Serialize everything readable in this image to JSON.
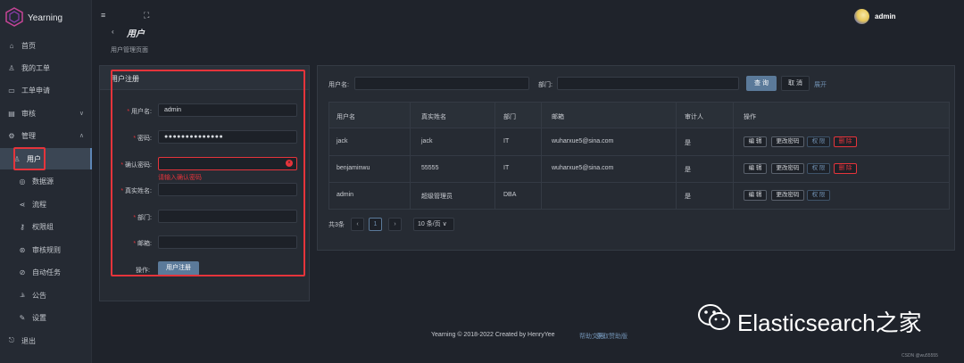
{
  "app": {
    "name": "Yearning"
  },
  "sidebar": {
    "items": [
      {
        "label": "首页",
        "icon": "home-icon"
      },
      {
        "label": "我的工单",
        "icon": "user-icon"
      },
      {
        "label": "工单申请",
        "icon": "keyboard-icon"
      },
      {
        "label": "审核",
        "icon": "audit-icon",
        "arrow": "∨"
      },
      {
        "label": "管理",
        "icon": "gear-icon",
        "arrow": "∧"
      },
      {
        "label": "用户",
        "icon": "user-icon"
      },
      {
        "label": "数据源",
        "icon": "eye-icon"
      },
      {
        "label": "流程",
        "icon": "flow-icon"
      },
      {
        "label": "权限组",
        "icon": "permission-icon"
      },
      {
        "label": "审核规则",
        "icon": "rule-icon"
      },
      {
        "label": "自动任务",
        "icon": "task-icon"
      },
      {
        "label": "公告",
        "icon": "chart-icon"
      },
      {
        "label": "设置",
        "icon": "settings-icon"
      },
      {
        "label": "退出",
        "icon": "logout-icon"
      }
    ]
  },
  "topbar": {
    "hamburger": "≡",
    "expand": "⛶",
    "user": "admin"
  },
  "page": {
    "back": "‹",
    "title": "用户",
    "subtitle": "用户管理页面"
  },
  "register": {
    "title": "用户注册",
    "fields": [
      {
        "label": "用户名:",
        "value": "admin",
        "required": true
      },
      {
        "label": "密码:",
        "value": "●●●●●●●●●●●●●●",
        "required": true
      },
      {
        "label": "确认密码:",
        "value": "",
        "required": true,
        "error": "请输入确认密码"
      },
      {
        "label": "真实姓名:",
        "value": "",
        "required": true
      },
      {
        "label": "部门:",
        "value": "",
        "required": true
      },
      {
        "label": "邮箱:",
        "value": "",
        "required": true
      }
    ],
    "ops_label": "操作:",
    "submit": "用户注册"
  },
  "search": {
    "user_label": "用户名:",
    "dept_label": "部门:",
    "query": "查 询",
    "cancel": "取 消",
    "expand": "展开"
  },
  "table": {
    "columns": [
      "用户名",
      "真实姓名",
      "部门",
      "邮箱",
      "审计人",
      "操作"
    ],
    "rows": [
      {
        "user": "jack",
        "real": "jack",
        "dept": "IT",
        "email": "wuharxue5@sina.com",
        "audit": "是",
        "delete": true
      },
      {
        "user": "benjaminwu",
        "real": "55555",
        "dept": "IT",
        "email": "wuharxue5@sina.com",
        "audit": "是",
        "delete": true
      },
      {
        "user": "admin",
        "real": "超级管理员",
        "dept": "DBA",
        "email": "",
        "audit": "是",
        "delete": false
      }
    ],
    "actions": {
      "edit": "编 辑",
      "change_pwd": "更改密码",
      "perm": "权 限",
      "del": "删 除"
    }
  },
  "pagination": {
    "total": "共3条",
    "prev": "‹",
    "page": "1",
    "next": "›",
    "size": "10 条/页 ∨"
  },
  "footer": {
    "text": "Yearning © 2018-2022 Created by HenryYee",
    "link1": "帮助文档",
    "link2": "获取赞助版"
  },
  "watermark": {
    "text": "Elasticsearch之家",
    "small": "CSDN @wu55555"
  }
}
